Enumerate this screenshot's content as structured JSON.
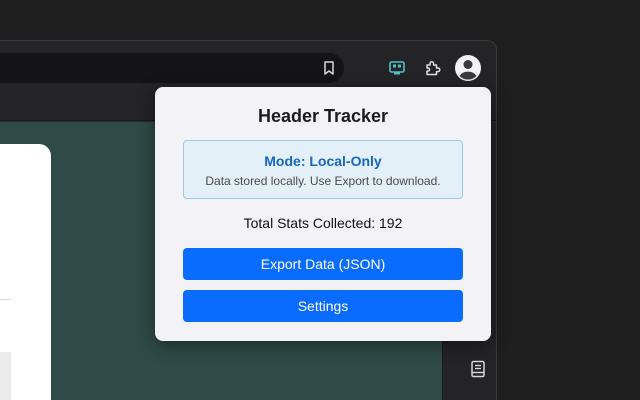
{
  "popup": {
    "title": "Header Tracker",
    "mode": {
      "label": "Mode: Local-Only",
      "description": "Data stored locally. Use Export to download."
    },
    "stats_text": "Total Stats Collected: 192",
    "buttons": {
      "export_label": "Export Data (JSON)",
      "settings_label": "Settings"
    }
  },
  "toolbar": {
    "icons": [
      "bookmark-icon",
      "header-tracker-extension-icon",
      "puzzle-icon",
      "profile-icon"
    ]
  },
  "sidepanel": {
    "icons": [
      "reading-list-icon"
    ]
  },
  "colors": {
    "accent": "#0a6cff",
    "mode_text": "#1766c4",
    "mode_bg": "#e3f0f7",
    "page_bg": "#2f4b47",
    "extension_icon": "#4fc3c8"
  }
}
